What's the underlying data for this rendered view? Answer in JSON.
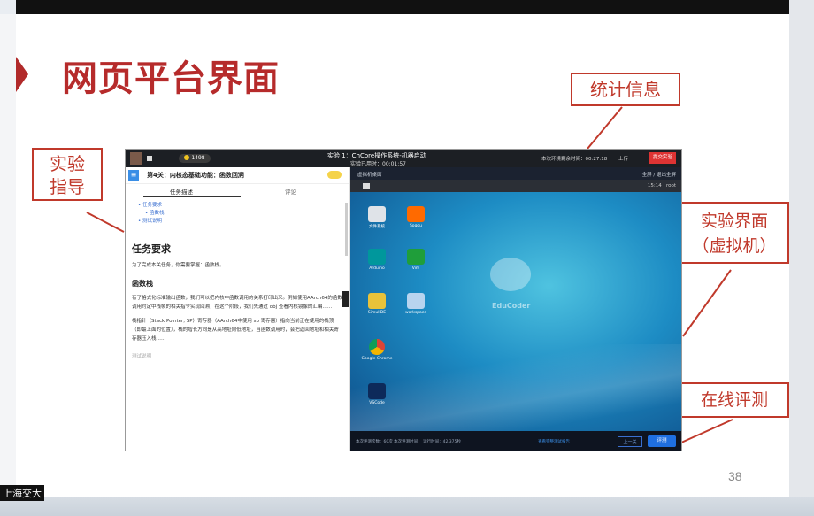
{
  "slide": {
    "title": "网页平台界面",
    "page_number": "38",
    "watermark": "上海交大",
    "callouts": {
      "guide": "实验\n指导",
      "stats": "统计信息",
      "vm": "实验界面\n（虚拟机）",
      "eval": "在线评测"
    }
  },
  "screenshot": {
    "topbar": {
      "coins": "1498",
      "experiment_title": "实验 1：ChCore操作系统-机器启动",
      "used_time": "实验已用时：00:01:57",
      "remaining": "本次环境剩余时间：00:27:18",
      "upload": "上传",
      "finish": "提交实验"
    },
    "guide": {
      "level_title": "第4关：内核态基础功能：函数回溯",
      "tab_task": "任务描述",
      "tab_comments": "评论",
      "toc": [
        "任务要求",
        "函数栈",
        "测试说明"
      ],
      "heading_task": "任务要求",
      "task_text": "为了完成本关任务，你需要掌握：函数栈。",
      "heading_stack": "函数栈",
      "para1": "有了格式化标准输出函数，我们可以把内核中函数调用的关系打印出来。例如使用AArch64的函数调用约定中栈帧的相关指令实现回溯，在这个阶段，我们先通过 obj 查看内核镜像的汇编……",
      "para2": "栈指针（Stack Pointer, SP）寄存器（AArch64中使用 sp 寄存器）指向当前正在使用的栈顶（即最上面的位置），栈的增长方向是从高地址向低地址，当函数调用时，会把返回地址和相关寄存器压入栈……",
      "footer_hint": "测试说明"
    },
    "vm": {
      "left_label": "虚拟机桌面",
      "right_label": "全屏 / 退出全屏",
      "clock": "15:14",
      "user": "root",
      "brand": "EduCoder",
      "icons": [
        {
          "label": "文件系统",
          "icon": "drive-icon"
        },
        {
          "label": "Sogou",
          "icon": "sogou-icon"
        },
        {
          "label": "Arduino",
          "icon": "arduino-icon"
        },
        {
          "label": "Vim",
          "icon": "vim-icon"
        },
        {
          "label": "SimulIDE",
          "icon": "simulide-icon"
        },
        {
          "label": "workspace",
          "icon": "folder-icon"
        },
        {
          "label": "Google Chrome",
          "icon": "chrome-icon"
        },
        {
          "label": "VSCode",
          "icon": "vscode-icon"
        }
      ]
    },
    "statusbar": {
      "text": "本次评测次数：60次    本次评测时间：    运行时间：42.375秒",
      "link": "查看完整测试报告",
      "prev": "上一关",
      "eval": "评测"
    }
  },
  "colors": {
    "accent": "#b62b2b",
    "callout": "#c0392b",
    "eval_button": "#1f6fe0"
  }
}
